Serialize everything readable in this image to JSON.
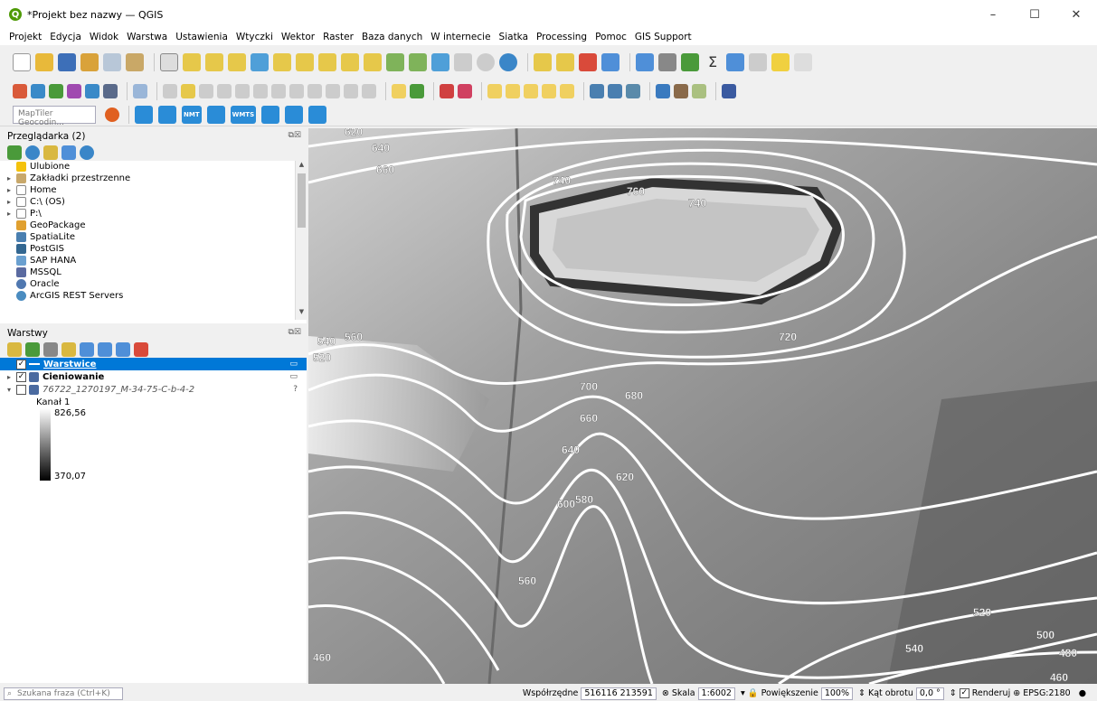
{
  "titlebar": {
    "title": "*Projekt bez nazwy — QGIS",
    "logo": "Q",
    "minimize": "–",
    "maximize": "☐",
    "close": "✕"
  },
  "menu": [
    "Projekt",
    "Edycja",
    "Widok",
    "Warstwa",
    "Ustawienia",
    "Wtyczki",
    "Wektor",
    "Raster",
    "Baza danych",
    "W internecie",
    "Siatka",
    "Processing",
    "Pomoc",
    "GIS Support"
  ],
  "toolbar3": {
    "geocoder_placeholder": "MapTiler Geocodin...",
    "nmt": "NMT",
    "wmts": "WMTS"
  },
  "browser": {
    "title": "Przeglądarka (2)",
    "items": [
      {
        "label": "Ulubione",
        "icon": "star-icon",
        "color": "#f4c20d"
      },
      {
        "label": "Zakładki przestrzenne",
        "icon": "bookmark-icon",
        "color": "#c8a86b"
      },
      {
        "label": "Home",
        "icon": "home-icon",
        "color": "#8b8b8b"
      },
      {
        "label": "C:\\ (OS)",
        "icon": "drive-icon",
        "color": "#9aa0a6"
      },
      {
        "label": "P:\\",
        "icon": "drive-icon",
        "color": "#9aa0a6"
      },
      {
        "label": "GeoPackage",
        "icon": "geopackage-icon",
        "color": "#e0a030"
      },
      {
        "label": "SpatiaLite",
        "icon": "spatialite-icon",
        "color": "#4a7fb0"
      },
      {
        "label": "PostGIS",
        "icon": "postgis-icon",
        "color": "#336791"
      },
      {
        "label": "SAP HANA",
        "icon": "saphana-icon",
        "color": "#6aa0d0"
      },
      {
        "label": "MSSQL",
        "icon": "mssql-icon",
        "color": "#5a6aa0"
      },
      {
        "label": "Oracle",
        "icon": "oracle-icon",
        "color": "#5078b0"
      },
      {
        "label": "ArcGIS REST Servers",
        "icon": "arcgis-icon",
        "color": "#4a8cc0"
      }
    ]
  },
  "layers": {
    "title": "Warstwy",
    "items": [
      {
        "label": "Warstwice",
        "checked": "✓"
      },
      {
        "label": "Cieniowanie",
        "checked": "✓"
      },
      {
        "label": "76722_1270197_M-34-75-C-b-4-2",
        "checked": ""
      }
    ],
    "legend": {
      "band": "Kanał 1",
      "max": "826,56",
      "min": "370,07"
    }
  },
  "map": {
    "contour_labels": [
      "620",
      "640",
      "660",
      "740",
      "760",
      "740",
      "720",
      "540",
      "560",
      "520",
      "700",
      "680",
      "660",
      "640",
      "620",
      "600",
      "580",
      "560",
      "520",
      "500",
      "540",
      "480",
      "460",
      "460"
    ]
  },
  "statusbar": {
    "search_placeholder": "Szukana fraza (Ctrl+K)",
    "coord_label": "Współrzędne",
    "coord_value": "516116 213591",
    "scale_label": "Skala",
    "scale_value": "1:6002",
    "magnifier_label": "Powiększenie",
    "magnifier_value": "100%",
    "rotation_label": "Kąt obrotu",
    "rotation_value": "0,0 °",
    "render_label": "Renderuj",
    "crs": "EPSG:2180"
  }
}
